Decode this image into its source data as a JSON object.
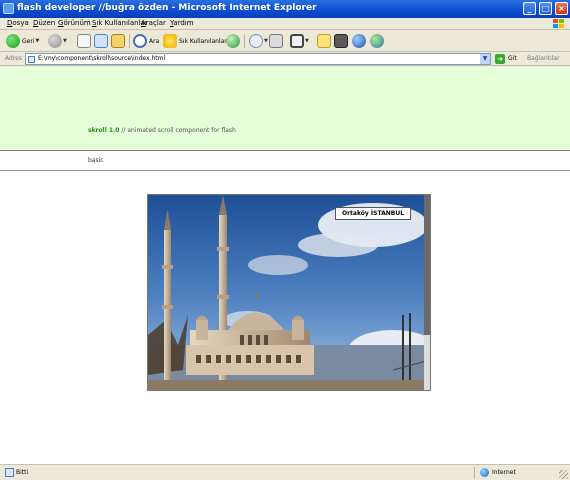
{
  "window": {
    "title": "flash developer //buğra özden - Microsoft Internet Explorer",
    "min_label": "_",
    "max_label": "□",
    "close_label": "×"
  },
  "menu": {
    "items": [
      {
        "u": "D",
        "rest": "osya"
      },
      {
        "u": "D",
        "rest": "üzen"
      },
      {
        "u": "G",
        "rest": "örünüm"
      },
      {
        "u": "S",
        "rest": "ık Kullanılanlar"
      },
      {
        "u": "A",
        "rest": "raçlar"
      },
      {
        "u": "Y",
        "rest": "ardım"
      }
    ]
  },
  "toolbar": {
    "back_label": "Geri",
    "search_label": "Ara",
    "favorites_label": "Sık Kullanılanlar"
  },
  "address": {
    "label": "Adres",
    "url": "E:\\my\\component\\skroll\\source\\index.html",
    "go_label": "Git",
    "links_label": "Bağlantılar"
  },
  "page": {
    "product": "skroll 1.0",
    "separator": " // ",
    "description": "animated scroll component for flash",
    "nav_link": "basic",
    "caption": "Ortaköy İSTANBUL"
  },
  "status": {
    "text": "Bitti",
    "zone": "Internet"
  },
  "colors": {
    "hero_bg": "#e5ffd8",
    "product_green": "#2f8a1c",
    "titlebar_blue": "#0a4bd0"
  },
  "icons": [
    "ie-icon",
    "back-icon",
    "forward-icon",
    "stop-icon",
    "refresh-icon",
    "home-icon",
    "search-icon",
    "favorites-icon",
    "media-icon",
    "mail-icon",
    "print-icon",
    "edit-icon",
    "folder-icon",
    "discuss-icon",
    "messenger-icon",
    "research-icon",
    "go-icon",
    "page-icon",
    "internet-zone-icon"
  ]
}
